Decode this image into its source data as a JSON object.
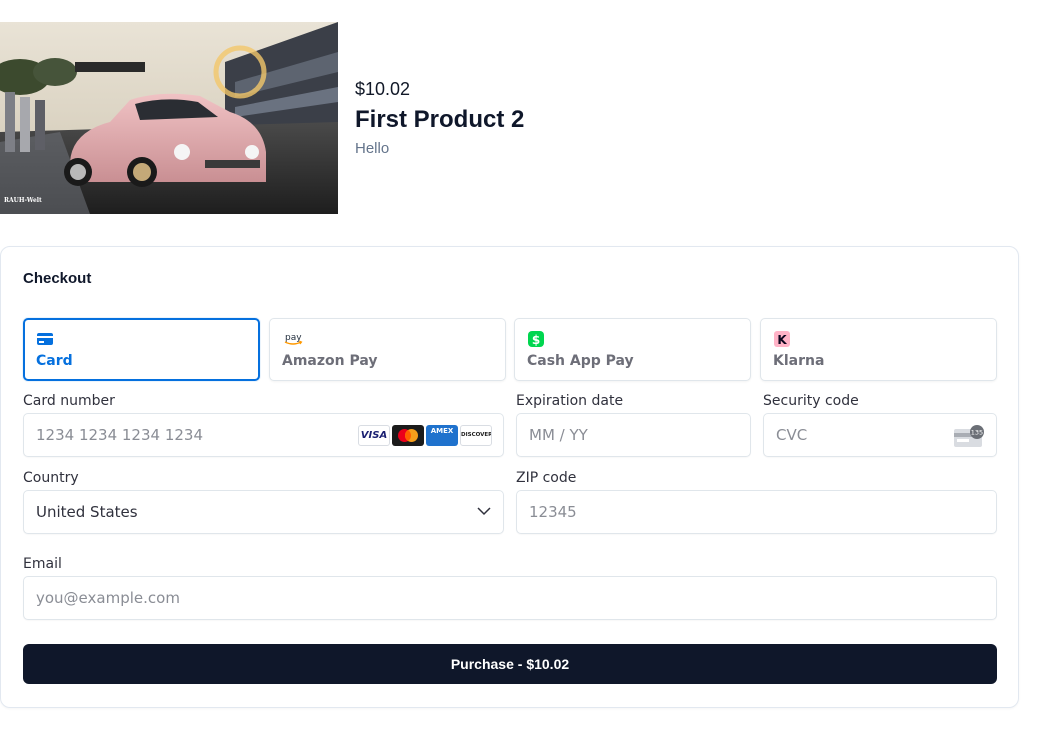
{
  "product": {
    "price": "$10.02",
    "name": "First Product 2",
    "description": "Hello",
    "image_alt": "Pink Porsche RWB at racetrack pit lane",
    "image_watermark": "RAUH-Welt"
  },
  "checkout": {
    "title": "Checkout",
    "payment_methods": [
      {
        "label": "Card",
        "icon": "card-icon",
        "active": true
      },
      {
        "label": "Amazon Pay",
        "icon": "amazon-pay-icon",
        "active": false
      },
      {
        "label": "Cash App Pay",
        "icon": "cash-app-icon",
        "active": false
      },
      {
        "label": "Klarna",
        "icon": "klarna-icon",
        "active": false
      }
    ],
    "card_number": {
      "label": "Card number",
      "placeholder": "1234 1234 1234 1234",
      "value": ""
    },
    "card_brands": [
      "VISA",
      "Mastercard",
      "AMEX",
      "DISCOVER"
    ],
    "expiration": {
      "label": "Expiration date",
      "placeholder": "MM / YY",
      "value": ""
    },
    "security_code": {
      "label": "Security code",
      "placeholder": "CVC",
      "value": "",
      "icon_text": "135"
    },
    "country": {
      "label": "Country",
      "value": "United States"
    },
    "zip": {
      "label": "ZIP code",
      "placeholder": "12345",
      "value": ""
    },
    "email": {
      "label": "Email",
      "placeholder": "you@example.com",
      "value": ""
    },
    "purchase_label": "Purchase - $10.02"
  },
  "colors": {
    "accent": "#0570de",
    "button_bg": "#0f172a",
    "cash_app": "#00d64f",
    "klarna": "#ffb3c7"
  }
}
